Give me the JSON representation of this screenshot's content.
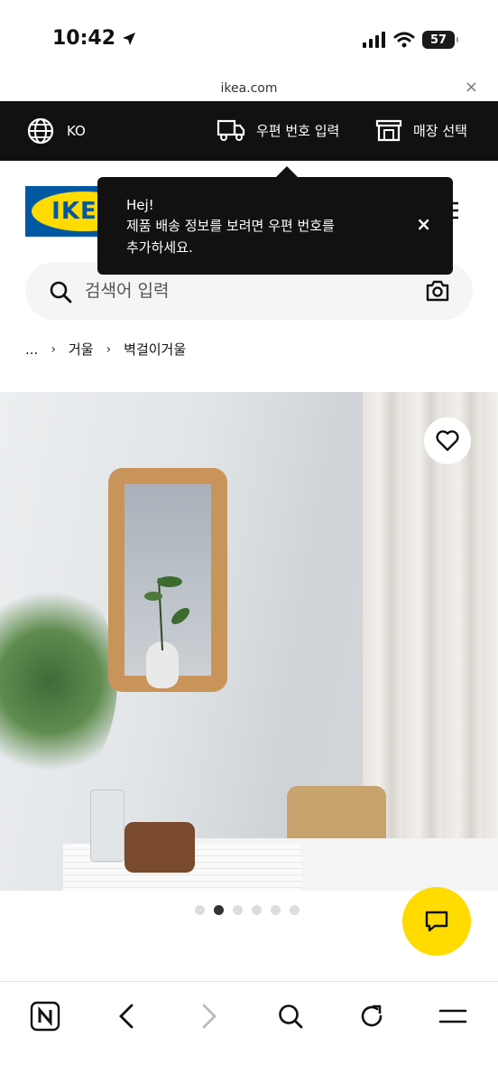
{
  "status_bar": {
    "time": "10:42",
    "battery": "57"
  },
  "browser": {
    "url": "ikea.com",
    "close_label": "×"
  },
  "top_bar": {
    "language": "KO",
    "zip_label": "우편 번호 입력",
    "store_label": "매장 선택"
  },
  "logo": {
    "text": "IKEA"
  },
  "tooltip": {
    "title": "Hej!",
    "line1": "제품 배송 정보를 보려면 우편 번호를",
    "line2": "추가하세요.",
    "close_label": "×"
  },
  "search": {
    "placeholder": "검색어 입력"
  },
  "breadcrumb": {
    "ellipsis": "...",
    "sep": "›",
    "item1": "거울",
    "item2": "벽걸이거울"
  },
  "carousel": {
    "count": 6,
    "active_index": 1
  },
  "icons": {
    "language": "globe-icon",
    "zip": "truck-icon",
    "store": "store-icon",
    "search": "search-icon",
    "camera": "camera-icon",
    "favorite": "heart-icon",
    "chat": "chat-icon",
    "menu": "menu-icon"
  },
  "colors": {
    "ikea_blue": "#0058a3",
    "ikea_yellow": "#ffdb00",
    "top_bar": "#111111"
  }
}
